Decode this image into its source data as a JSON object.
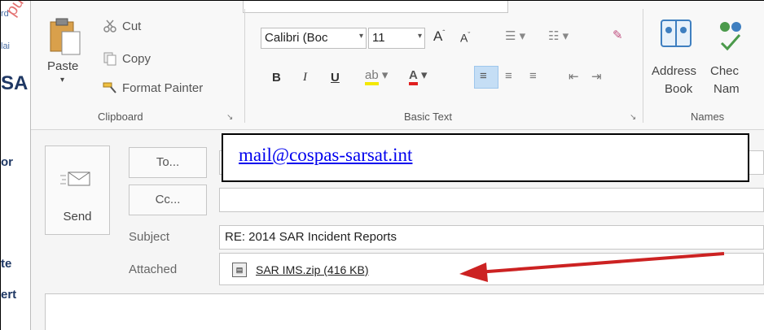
{
  "document_behind": {
    "fragments": [
      "rd",
      "lai",
      "SA",
      "or",
      "te",
      "ert"
    ],
    "watermark": "publications"
  },
  "ribbon": {
    "clipboard": {
      "paste": "Paste",
      "cut": "Cut",
      "copy": "Copy",
      "format_painter": "Format Painter",
      "group_label": "Clipboard"
    },
    "basic_text": {
      "font_name": "Calibri (Boc",
      "font_size": "11",
      "bold": "B",
      "italic": "I",
      "underline": "U",
      "group_label": "Basic Text"
    },
    "names": {
      "address_book_line1": "Address",
      "address_book_line2": "Book",
      "check_names_line1": "Chec",
      "check_names_line2": "Nam",
      "group_label": "Names"
    }
  },
  "compose": {
    "send": "Send",
    "to": "To...",
    "cc": "Cc...",
    "subject_label": "Subject",
    "subject_value": "RE: 2014 SAR Incident Reports",
    "attached_label": "Attached",
    "attachment": "SAR IMS.zip (416 KB)"
  },
  "overlay": {
    "email": "mail@cospas-sarsat.int"
  },
  "colors": {
    "arrow": "#cc2222",
    "link": "#0000ee"
  }
}
